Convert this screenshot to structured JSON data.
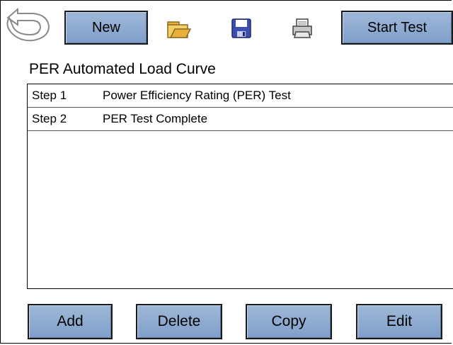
{
  "toolbar": {
    "new_label": "New",
    "start_test_label": "Start Test",
    "icons": [
      "back-arrow-icon",
      "open-folder-icon",
      "save-disk-icon",
      "printer-icon"
    ]
  },
  "title": "PER Automated Load Curve",
  "steps": [
    {
      "step": "Step 1",
      "description": "Power Efficiency Rating (PER) Test"
    },
    {
      "step": "Step 2",
      "description": "PER Test Complete"
    }
  ],
  "actions": {
    "add_label": "Add",
    "delete_label": "Delete",
    "copy_label": "Copy",
    "edit_label": "Edit"
  },
  "colors": {
    "button_fill": "#8faad0",
    "button_border": "#1a1a1a",
    "folder": "#e8b038",
    "disk": "#3a4fb0"
  }
}
